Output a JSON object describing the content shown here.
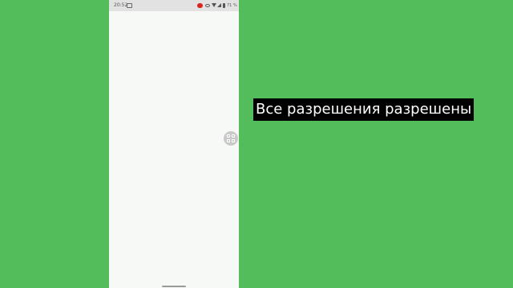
{
  "status_bar": {
    "time": "20:52",
    "battery": "71 %",
    "icons": [
      "cast-icon",
      "screen-record-icon",
      "eye-icon",
      "wifi-icon",
      "signal-icon",
      "battery-icon"
    ]
  },
  "floating_button": {
    "icon": "grid-icon"
  },
  "caption": {
    "text": "Все разрешения разрешены"
  },
  "colors": {
    "background": "#53bd5b",
    "phone_screen": "#f7f9f6",
    "status_bar": "#e2e2e2",
    "record_dot": "#d9251f",
    "caption_bg": "#000000",
    "caption_text": "#ffffff"
  }
}
